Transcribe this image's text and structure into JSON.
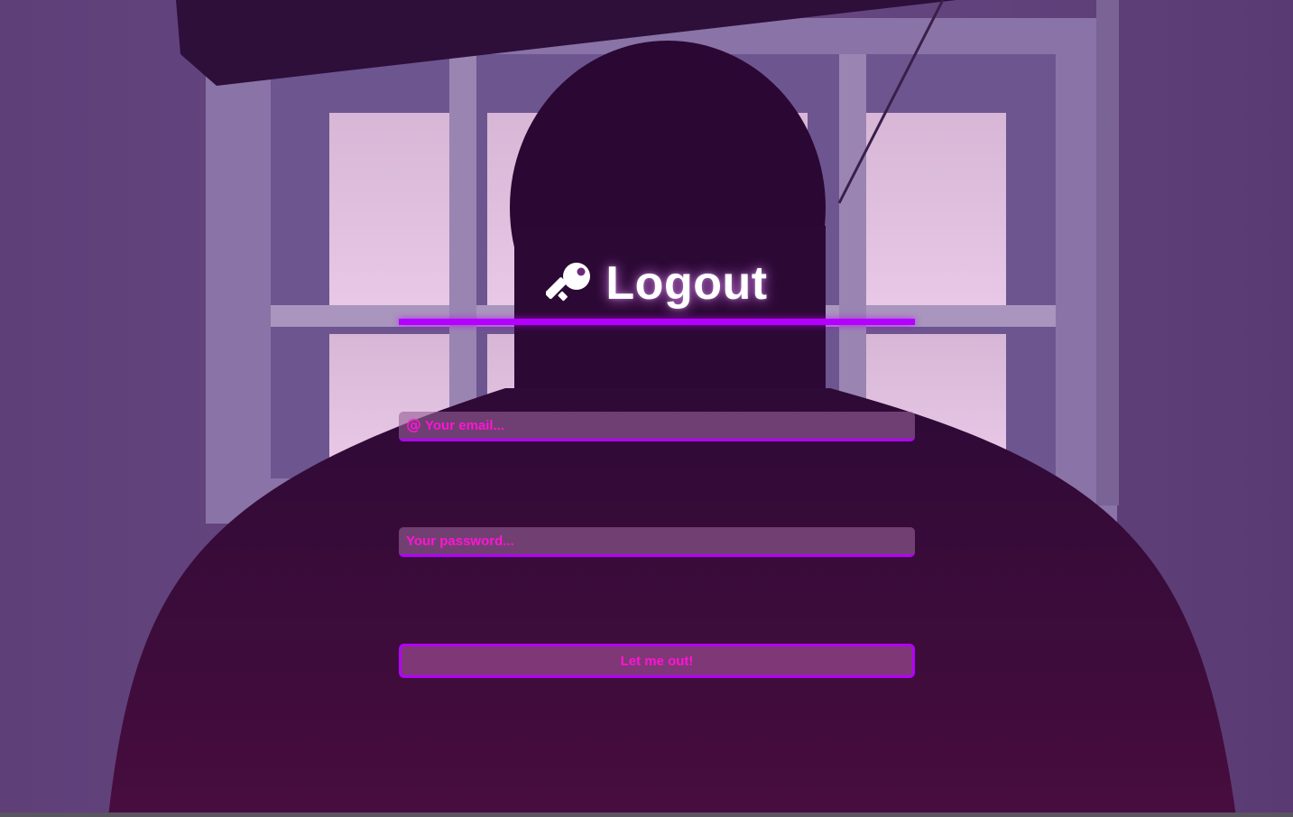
{
  "page": {
    "title": "Logout",
    "title_icon": "key-icon"
  },
  "form": {
    "email": {
      "icon": "at-icon",
      "icon_glyph": "@",
      "placeholder": "Your email...",
      "value": ""
    },
    "password": {
      "placeholder": "Your password...",
      "value": ""
    },
    "submit_label": "Let me out!"
  },
  "colors": {
    "accent": "#b400ff",
    "text_accent": "#ff14d4",
    "title_text": "#ffffff"
  }
}
